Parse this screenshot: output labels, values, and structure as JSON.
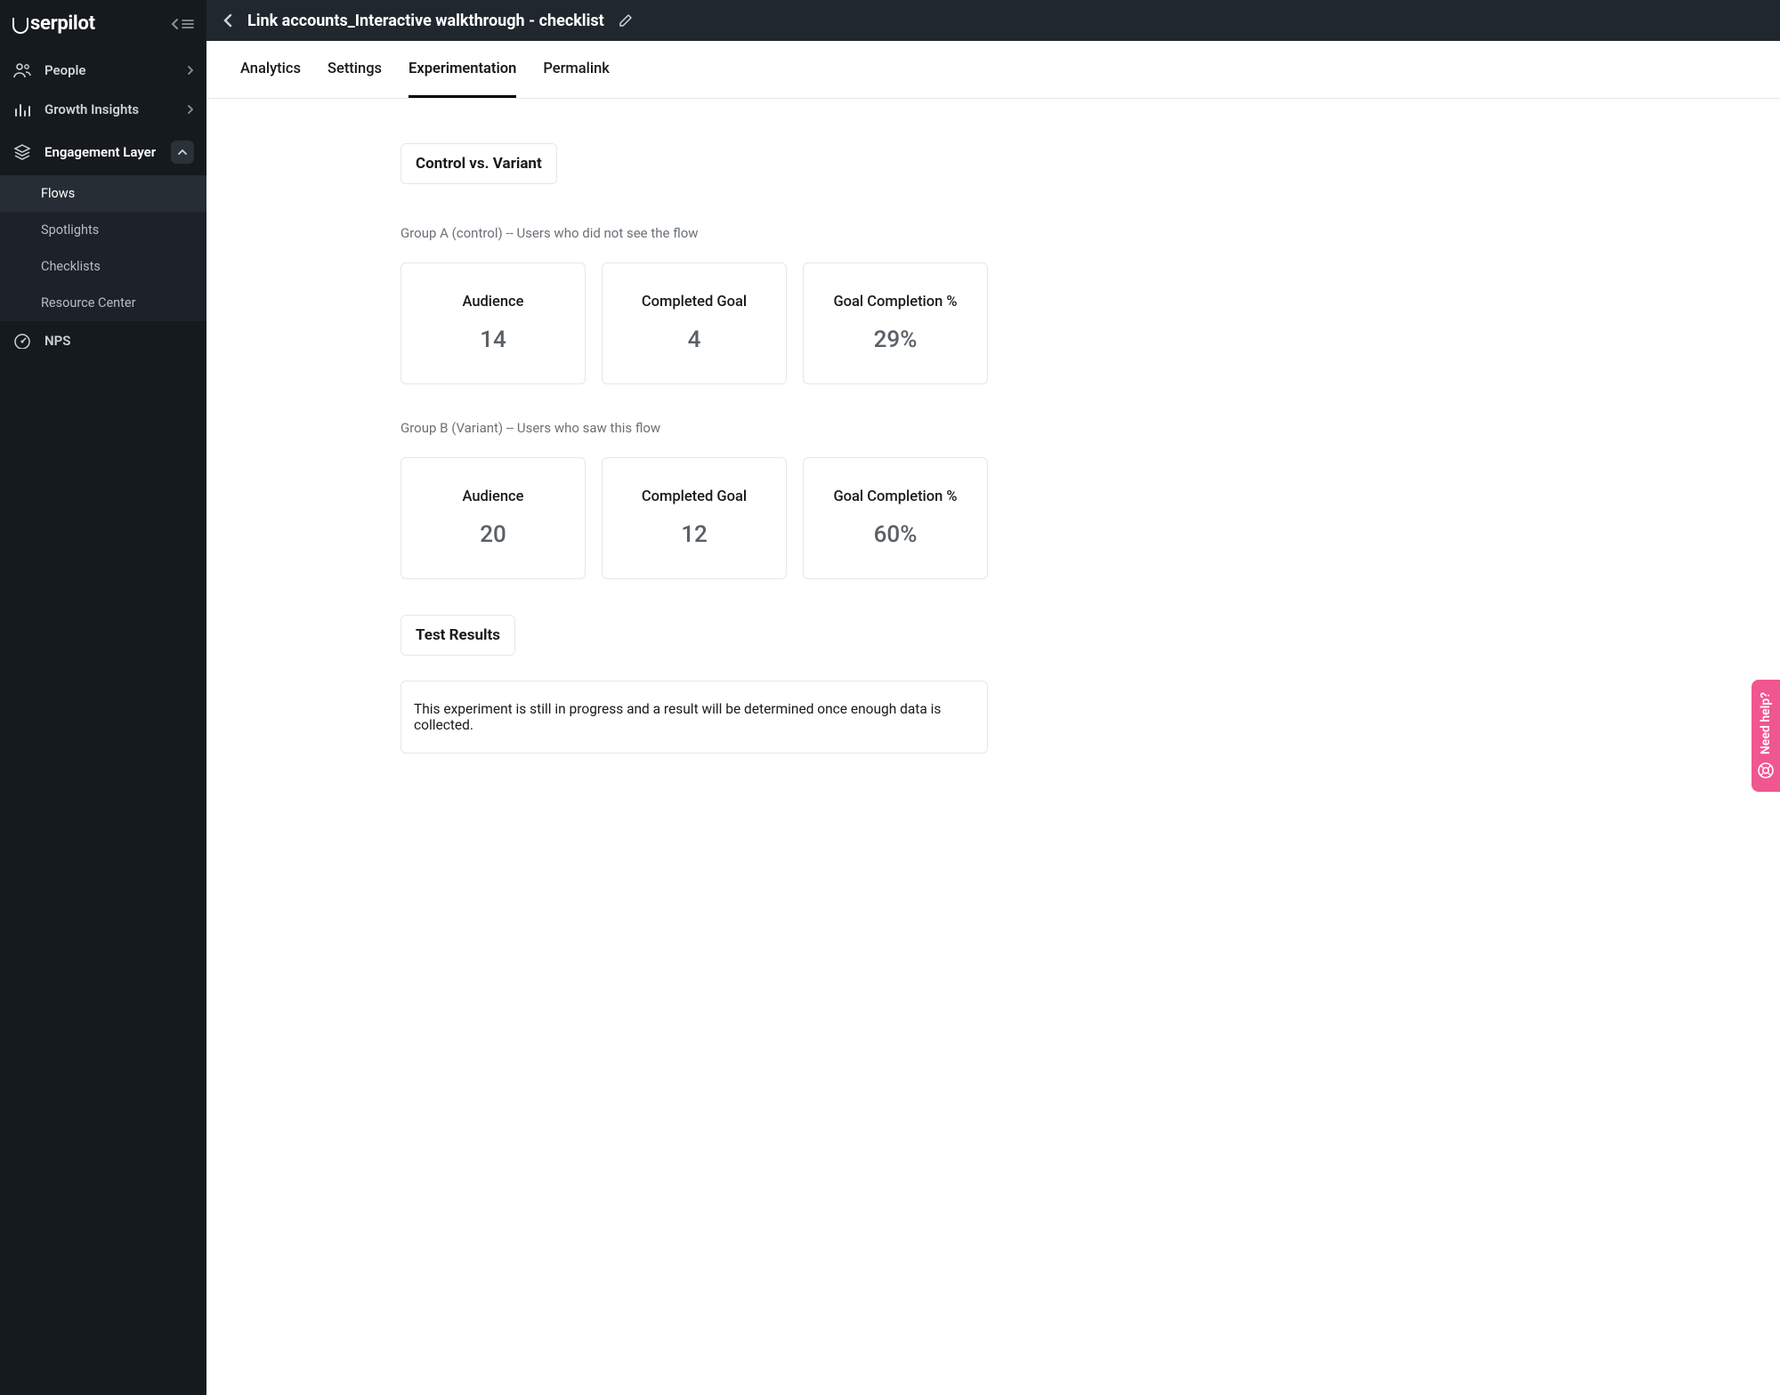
{
  "brand": "serpilot",
  "sidebar": {
    "items": [
      {
        "label": "People",
        "icon": "people"
      },
      {
        "label": "Growth Insights",
        "icon": "bars"
      },
      {
        "label": "Engagement Layer",
        "icon": "layers",
        "expanded": true
      },
      {
        "label": "NPS",
        "icon": "gauge"
      }
    ],
    "engagement_subitems": [
      {
        "label": "Flows",
        "active": true
      },
      {
        "label": "Spotlights"
      },
      {
        "label": "Checklists"
      },
      {
        "label": "Resource Center"
      }
    ]
  },
  "header": {
    "title": "Link accounts_Interactive walkthrough - checklist"
  },
  "tabs": [
    {
      "label": "Analytics"
    },
    {
      "label": "Settings"
    },
    {
      "label": "Experimentation",
      "active": true
    },
    {
      "label": "Permalink"
    }
  ],
  "experiment": {
    "section1_title": "Control vs. Variant",
    "group_a": {
      "description": "Group A (control) -- Users who did not see the flow",
      "metrics": {
        "audience_label": "Audience",
        "audience_value": "14",
        "completed_label": "Completed Goal",
        "completed_value": "4",
        "rate_label": "Goal Completion %",
        "rate_value": "29%"
      }
    },
    "group_b": {
      "description": "Group B (Variant) -- Users who saw this flow",
      "metrics": {
        "audience_label": "Audience",
        "audience_value": "20",
        "completed_label": "Completed Goal",
        "completed_value": "12",
        "rate_label": "Goal Completion %",
        "rate_value": "60%"
      }
    },
    "section2_title": "Test Results",
    "result_text": "This experiment is still in progress and a result will be determined once enough data is collected."
  },
  "help": {
    "label": "Need help?"
  }
}
